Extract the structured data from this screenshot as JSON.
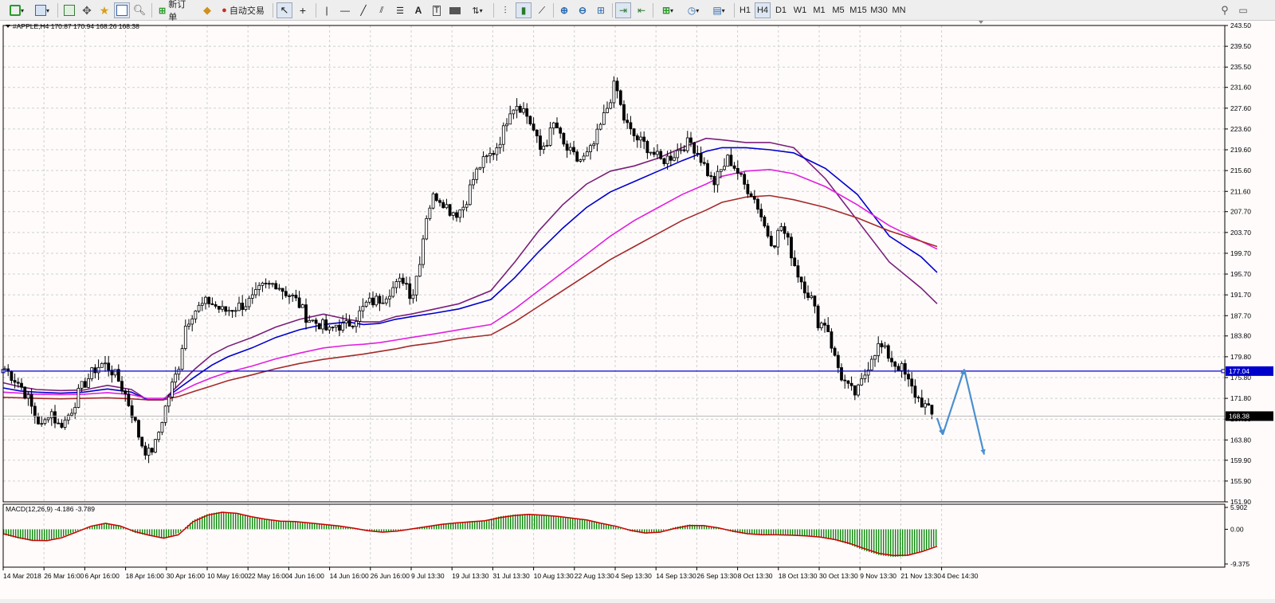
{
  "toolbar": {
    "new_order_label": "新订单",
    "auto_trade_label": "自动交易",
    "timeframes": [
      "H1",
      "H4",
      "D1",
      "W1",
      "M1",
      "M5",
      "M15",
      "M30",
      "MN"
    ],
    "active_timeframe": "H4"
  },
  "chart_data": {
    "type": "candlestick",
    "symbol_info": "#APPLE,H4  170.87 170.94 168.26 168.38",
    "price_axis": [
      "243.50",
      "239.50",
      "235.50",
      "231.60",
      "227.60",
      "223.60",
      "219.60",
      "215.60",
      "211.60",
      "207.70",
      "203.70",
      "199.70",
      "195.70",
      "191.70",
      "187.70",
      "183.80",
      "179.80",
      "175.80",
      "171.80",
      "167.80",
      "163.80",
      "159.90",
      "155.90",
      "151.90"
    ],
    "price_range": [
      151.9,
      243.5
    ],
    "time_axis": [
      "14 Mar 2018",
      "26 Mar 16:00",
      "6 Apr 16:00",
      "18 Apr 16:00",
      "30 Apr 16:00",
      "10 May 16:00",
      "22 May 16:00",
      "4 Jun 16:00",
      "14 Jun 16:00",
      "26 Jun 16:00",
      "9 Jul 13:30",
      "19 Jul 13:30",
      "31 Jul 13:30",
      "10 Aug 13:30",
      "22 Aug 13:30",
      "4 Sep 13:30",
      "14 Sep 13:30",
      "26 Sep 13:30",
      "8 Oct 13:30",
      "18 Oct 13:30",
      "30 Oct 13:30",
      "9 Nov 13:30",
      "21 Nov 13:30",
      "4 Dec 14:30"
    ],
    "horizontal_line": {
      "value": 177.04,
      "label": "177.04",
      "color": "#0000cc"
    },
    "current_price": {
      "value": 168.38,
      "label": "168.38"
    },
    "price_path": [
      177.5,
      176,
      174.5,
      172,
      168.5,
      166,
      170,
      166.5,
      167.5,
      170,
      173.5,
      175.5,
      177.5,
      178.5,
      177.5,
      175.5,
      172.5,
      168.5,
      163.5,
      161,
      163,
      168.5,
      173.5,
      177.5,
      186,
      188.5,
      189.5,
      190.5,
      189.5,
      188.5,
      189,
      189.5,
      190,
      191,
      193,
      193.5,
      194,
      192.5,
      191.5,
      190,
      187.5,
      186.5,
      186,
      184.5,
      186,
      185.5,
      186.5,
      188,
      190,
      190.5,
      191,
      192.5,
      193.5,
      195,
      191,
      198,
      207.5,
      211,
      210,
      208,
      207.5,
      209,
      213.5,
      216.5,
      218,
      219.5,
      222.5,
      227.5,
      228.5,
      227,
      224,
      219.5,
      221.5,
      225,
      220.5,
      219,
      217.5,
      218,
      220,
      224,
      228,
      232.5,
      226,
      223,
      221.5,
      220.5,
      219,
      217.5,
      218,
      219,
      220.5,
      221,
      219,
      216,
      213,
      215.5,
      218,
      216,
      213,
      211.5,
      208.5,
      204,
      201.5,
      205,
      201.5,
      196.5,
      193.5,
      191,
      186,
      186.5,
      180,
      176,
      173.5,
      172.5,
      176,
      180,
      182,
      180.5,
      178.5,
      177.5,
      174.5,
      172,
      170.5,
      168.5
    ],
    "moving_averages": [
      {
        "color": "#7a1f7a",
        "values": [
          174.8,
          174.0,
          173.5,
          173.3,
          173.4,
          174.3,
          173.5,
          171.5,
          171.5,
          174.5,
          177.5,
          180.2,
          181.8,
          183.5,
          185.5,
          187.0,
          188.0,
          187.0,
          186.5,
          186.5,
          187.5,
          188.0,
          189.0,
          190.0,
          192.5,
          198.0,
          204.0,
          209.0,
          213.0,
          215.5,
          216.5,
          218.0,
          220.0,
          221.8,
          221.5,
          221.0,
          221.0,
          220.0,
          214.0,
          206.0,
          198.0,
          193.0,
          190.0
        ]
      },
      {
        "color": "#0000cc",
        "values": [
          173.8,
          173.2,
          173.0,
          172.8,
          173.0,
          173.6,
          173.0,
          171.5,
          171.5,
          173.8,
          176.0,
          178.2,
          179.8,
          181.5,
          183.5,
          185.0,
          186.0,
          186.5,
          186.0,
          186.2,
          187.0,
          187.5,
          188.2,
          189.0,
          190.8,
          195.0,
          200.0,
          204.5,
          208.5,
          211.5,
          213.5,
          215.5,
          217.5,
          219.3,
          220.0,
          220.0,
          219.6,
          219.0,
          216.0,
          211.0,
          203.0,
          199.0,
          196.0
        ]
      },
      {
        "color": "#e020e0",
        "values": [
          173.0,
          172.8,
          172.6,
          172.5,
          172.6,
          172.9,
          172.5,
          171.8,
          171.8,
          173.0,
          174.5,
          175.8,
          176.8,
          178.0,
          179.4,
          180.5,
          181.5,
          182.0,
          182.2,
          182.5,
          183.0,
          183.5,
          184.2,
          185.0,
          186.0,
          189.0,
          192.5,
          196.0,
          199.5,
          203.0,
          206.0,
          208.5,
          211.0,
          213.0,
          214.5,
          215.5,
          215.8,
          215.0,
          212.5,
          209.0,
          205.0,
          202.0,
          200.5
        ]
      },
      {
        "color": "#a52a2a",
        "values": [
          172.0,
          171.9,
          171.8,
          171.7,
          171.8,
          171.9,
          171.7,
          171.5,
          171.5,
          172.2,
          173.2,
          174.2,
          175.2,
          176.3,
          177.5,
          178.5,
          179.3,
          179.9,
          180.3,
          180.8,
          181.3,
          181.9,
          182.5,
          183.3,
          184.0,
          186.5,
          189.5,
          192.5,
          195.5,
          198.5,
          201.0,
          203.5,
          206.0,
          208.0,
          209.5,
          210.5,
          210.8,
          210.0,
          208.5,
          206.5,
          204.0,
          202.0,
          201.0
        ]
      }
    ],
    "ma_dates": [
      0,
      22,
      42,
      72,
      101,
      131,
      161,
      181,
      201,
      221,
      241,
      262,
      282,
      312,
      342,
      372,
      402,
      432,
      452,
      472,
      492,
      512,
      542,
      572,
      612,
      642,
      672,
      702,
      732,
      762,
      792,
      822,
      852,
      882,
      902,
      932,
      962,
      992,
      1032,
      1072,
      1112,
      1152,
      1172
    ],
    "projection": [
      {
        "from": [
          1172,
          168.0
        ],
        "to": [
          1179,
          164.8
        ],
        "color": "#4a90d0"
      },
      {
        "from": [
          1179,
          164.8
        ],
        "to": [
          1206,
          177.4
        ],
        "color": "#4a90d0"
      },
      {
        "from": [
          1206,
          177.4
        ],
        "to": [
          1231,
          161.0
        ],
        "color": "#4a90d0"
      }
    ],
    "macd": {
      "label": "MACD(12,26,9) -4.186 -3.789",
      "axis": [
        "5.902",
        "0.00",
        "-9.375"
      ],
      "range": [
        -9.375,
        5.902
      ],
      "histogram": [
        -1.5,
        -2.5,
        -3.2,
        -3.0,
        -2.0,
        -0.5,
        1.0,
        1.8,
        0.8,
        -1.0,
        -1.8,
        -2.6,
        -1.0,
        2.5,
        4.2,
        4.8,
        4.2,
        3.2,
        2.6,
        2.1,
        2.2,
        1.6,
        1.2,
        0.8,
        0.1,
        -0.6,
        -0.9,
        -0.3,
        0.3,
        0.9,
        1.5,
        1.8,
        2.2,
        2.4,
        3.5,
        4.0,
        4.2,
        3.8,
        3.5,
        3.0,
        2.4,
        1.5,
        0.6,
        -0.6,
        -1.2,
        -0.6,
        0.6,
        1.3,
        1.0,
        0.2,
        -0.8,
        -1.4,
        -1.6,
        -1.5,
        -1.7,
        -1.9,
        -2.2,
        -3.0,
        -4.2,
        -5.8,
        -7.0,
        -7.5,
        -7.2,
        -5.8,
        -4.3
      ],
      "signal": [
        -1.2,
        -2.2,
        -3.0,
        -3.1,
        -2.3,
        -0.8,
        0.8,
        1.6,
        0.9,
        -0.6,
        -1.6,
        -2.4,
        -1.5,
        2.0,
        3.8,
        4.6,
        4.3,
        3.4,
        2.7,
        2.2,
        2.1,
        1.7,
        1.3,
        0.9,
        0.3,
        -0.4,
        -0.8,
        -0.5,
        0.1,
        0.7,
        1.3,
        1.7,
        2.0,
        2.3,
        3.1,
        3.7,
        4.0,
        3.8,
        3.5,
        3.0,
        2.5,
        1.6,
        0.8,
        -0.3,
        -1.0,
        -0.8,
        0.2,
        1.0,
        1.0,
        0.4,
        -0.5,
        -1.2,
        -1.5,
        -1.5,
        -1.6,
        -1.8,
        -2.1,
        -2.8,
        -3.8,
        -5.2,
        -6.5,
        -7.1,
        -7.0,
        -6.0,
        -4.6
      ]
    }
  }
}
